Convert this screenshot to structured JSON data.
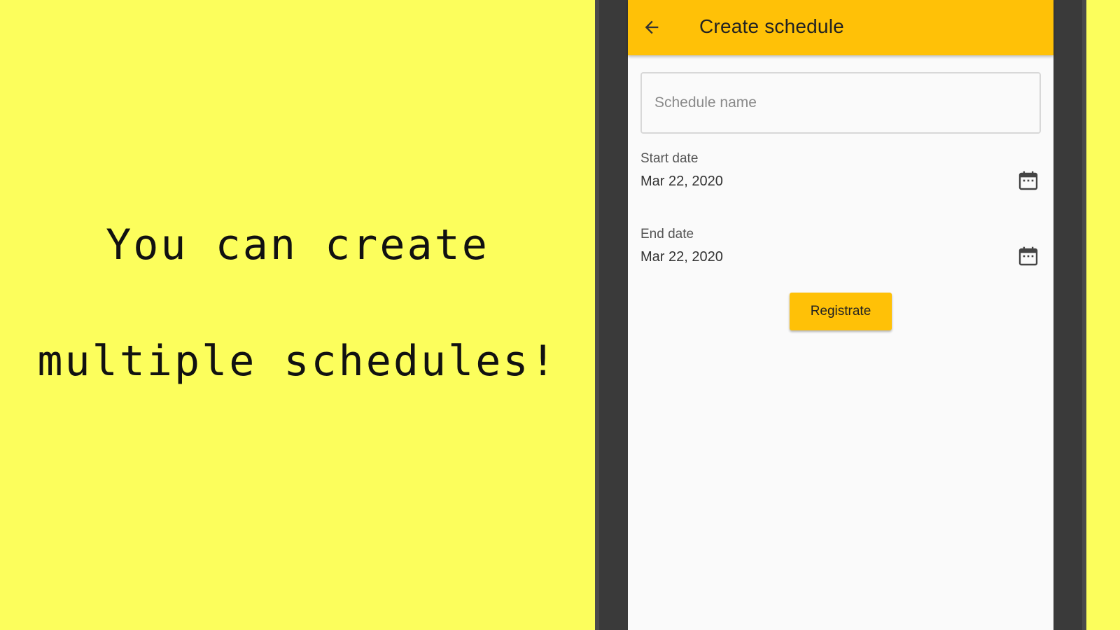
{
  "promo": {
    "line1": "You can create",
    "line2": "multiple schedules!"
  },
  "appbar": {
    "back_icon": "arrow-back-icon",
    "title": "Create schedule"
  },
  "form": {
    "schedule_name": {
      "placeholder": "Schedule name",
      "value": ""
    },
    "start_date": {
      "label": "Start date",
      "value": "Mar 22, 2020",
      "icon": "calendar-icon"
    },
    "end_date": {
      "label": "End date",
      "value": "Mar 22, 2020",
      "icon": "calendar-icon"
    },
    "submit_label": "Registrate"
  },
  "colors": {
    "background": "#fcfe5c",
    "appbar": "#ffc107",
    "button": "#ffc107",
    "phone_frame": "#3a3a3a",
    "screen": "#fafafa"
  }
}
